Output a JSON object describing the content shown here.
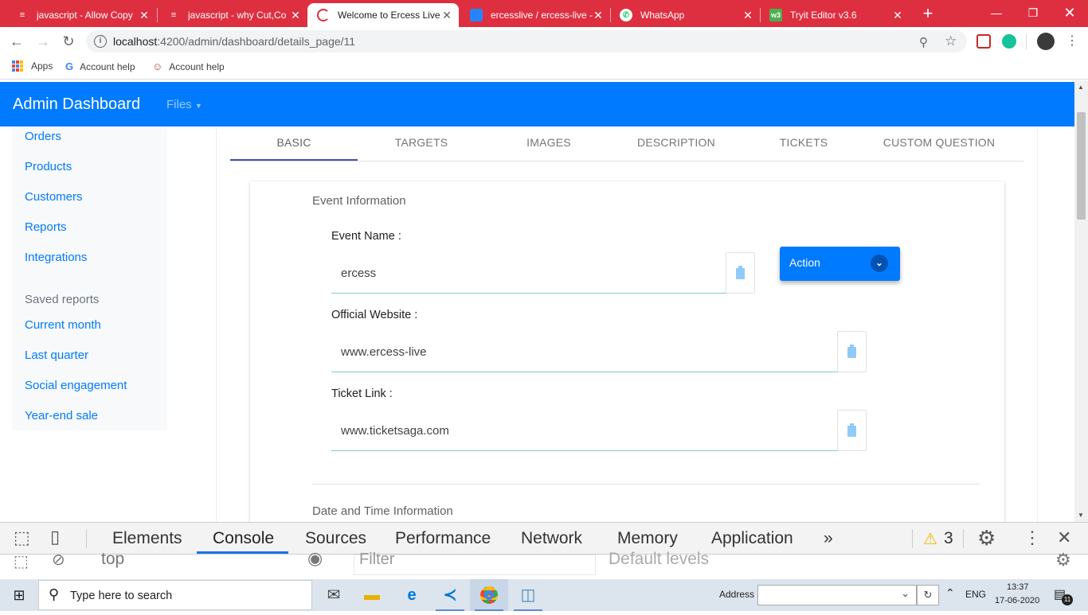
{
  "browser": {
    "tabs": [
      {
        "title": "javascript - Allow Copy",
        "icon": "stackoverflow-icon",
        "active": false
      },
      {
        "title": "javascript - why Cut,Co",
        "icon": "stackoverflow-icon",
        "active": false
      },
      {
        "title": "Welcome to Ercess Live",
        "icon": "ercess-icon",
        "active": true
      },
      {
        "title": "ercesslive / ercess-live -",
        "icon": "bitbucket-icon",
        "active": false
      },
      {
        "title": "WhatsApp",
        "icon": "whatsapp-icon",
        "active": false
      },
      {
        "title": "Tryit Editor v3.6",
        "icon": "w3schools-icon",
        "active": false
      }
    ],
    "url_host": "localhost",
    "url_rest": ":4200/admin/dashboard/details_page/11",
    "bookmarks": [
      {
        "label": "Apps",
        "icon": "apps-grid-icon"
      },
      {
        "label": "Account help",
        "icon": "google-icon"
      },
      {
        "label": "Account help",
        "icon": "emoji-icon"
      }
    ]
  },
  "app": {
    "brand": "Admin Dashboard",
    "files_menu": "Files",
    "sidebar": {
      "items": [
        "Orders",
        "Products",
        "Customers",
        "Reports",
        "Integrations"
      ],
      "saved_heading": "Saved reports",
      "saved": [
        "Current month",
        "Last quarter",
        "Social engagement",
        "Year-end sale"
      ]
    },
    "tabs": [
      "BASIC",
      "TARGETS",
      "IMAGES",
      "DESCRIPTION",
      "TICKETS",
      "CUSTOM QUESTION"
    ],
    "active_tab": "BASIC",
    "form": {
      "section_title": "Event Information",
      "event_name_label": "Event Name :",
      "event_name_value": "ercess",
      "website_label": "Official Website :",
      "website_value": "www.ercess-live",
      "ticket_label": "Ticket Link :",
      "ticket_value": "www.ticketsaga.com",
      "next_section_title": "Date and Time Information"
    },
    "action_button": "Action"
  },
  "devtools": {
    "tabs": [
      "Elements",
      "Console",
      "Sources",
      "Performance",
      "Network",
      "Memory",
      "Application"
    ],
    "active_tab": "Console",
    "more": "»",
    "warnings": "3",
    "context": "top",
    "filter_placeholder": "Filter",
    "levels": "Default levels"
  },
  "taskbar": {
    "search_placeholder": "Type here to search",
    "address_label": "Address",
    "language": "ENG",
    "time": "13:37",
    "date": "17-06-2020",
    "notification_count": "11"
  },
  "colors": {
    "tabstrip": "#DE2F40",
    "appbar": "#007BFF",
    "link": "#007BFF",
    "tab_indicator": "#3F51B5"
  }
}
